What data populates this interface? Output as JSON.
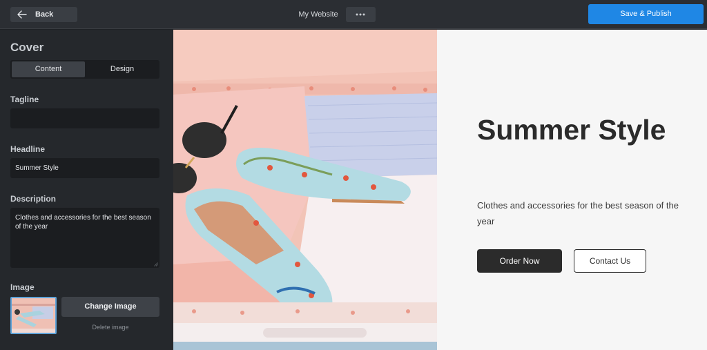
{
  "topbar": {
    "back_label": "Back",
    "site_title": "My Website",
    "publish_label": "Save & Publish"
  },
  "sidebar": {
    "section_title": "Cover",
    "tabs": [
      {
        "label": "Content",
        "active": true
      },
      {
        "label": "Design",
        "active": false
      }
    ],
    "tagline": {
      "label": "Tagline",
      "value": ""
    },
    "headline": {
      "label": "Headline",
      "value": "Summer Style"
    },
    "description": {
      "label": "Description",
      "value": "Clothes and accessories for the best season of the year"
    },
    "image": {
      "label": "Image",
      "change_label": "Change Image",
      "delete_label": "Delete image"
    }
  },
  "preview": {
    "headline": "Summer Style",
    "description": "Clothes and accessories for the best season of the year",
    "primary_button": "Order Now",
    "secondary_button": "Contact Us"
  },
  "colors": {
    "accent": "#1f87e5",
    "sidebar_bg": "#25282c",
    "dark_button": "#2b2b2b"
  }
}
